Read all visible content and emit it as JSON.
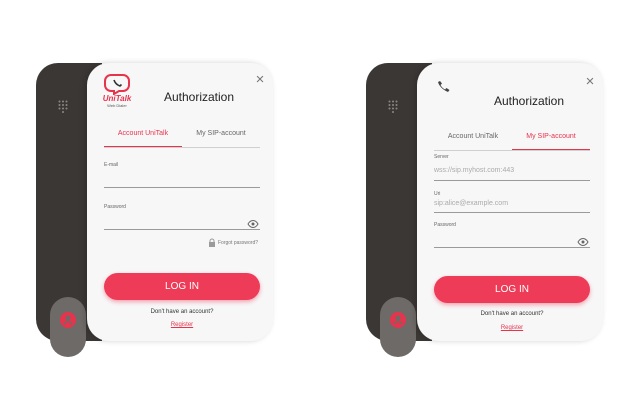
{
  "brand": {
    "name": "UniTalk",
    "sub": "Web Dialer"
  },
  "colors": {
    "accent": "#e8334d",
    "button": "#ee3b57",
    "sidebar": "#3b3735"
  },
  "panels": [
    {
      "title": "Authorization",
      "tabs": [
        {
          "label": "Account UniTalk",
          "active": true
        },
        {
          "label": "My SIP-account",
          "active": false
        }
      ],
      "fields": [
        {
          "label": "E-mail",
          "value": ""
        },
        {
          "label": "Password",
          "value": ""
        }
      ],
      "forgot": "Forgot password?",
      "login": "LOG IN",
      "no_account": "Don't have an account?",
      "register": "Register"
    },
    {
      "title": "Authorization",
      "tabs": [
        {
          "label": "Account UniTalk",
          "active": false
        },
        {
          "label": "My SIP-account",
          "active": true
        }
      ],
      "fields": [
        {
          "label": "Server",
          "placeholder": "wss://sip.myhost.com:443"
        },
        {
          "label": "Uri",
          "placeholder": "sip:alice@example.com"
        },
        {
          "label": "Password",
          "value": ""
        }
      ],
      "login": "LOG IN",
      "no_account": "Don't have an account?",
      "register": "Register"
    }
  ]
}
